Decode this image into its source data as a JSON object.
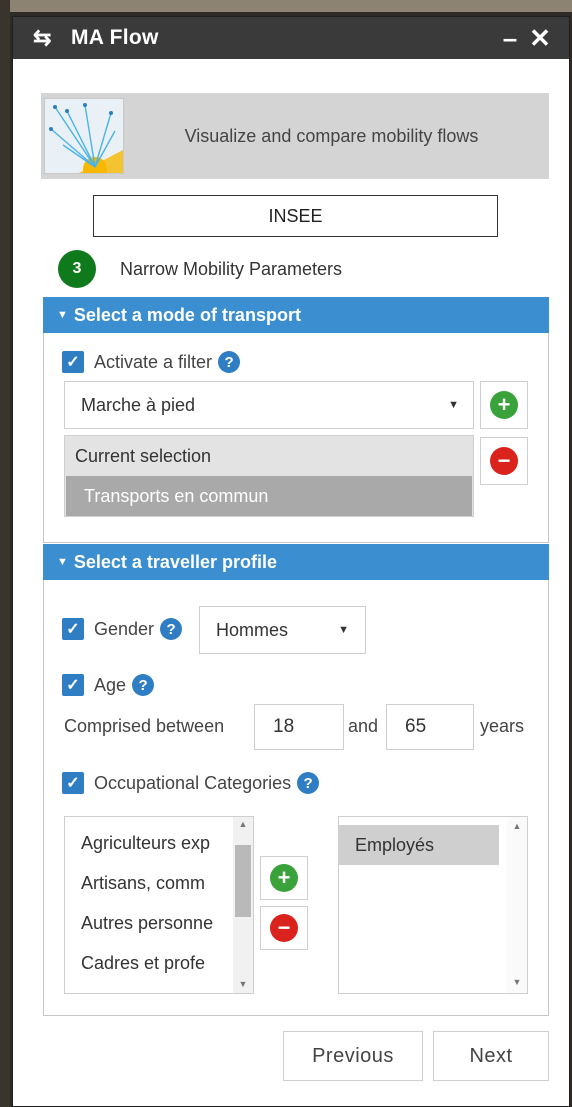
{
  "window": {
    "title": "MA Flow",
    "app_icon": "swap-arrows-icon",
    "minimize_label": "–",
    "close_label": "✕"
  },
  "banner": {
    "text": "Visualize and compare mobility flows",
    "thumbnail": "flow-map-thumbnail"
  },
  "source": {
    "label": "INSEE"
  },
  "step": {
    "number": "3",
    "label": "Narrow Mobility Parameters",
    "badge_color": "#0e7a1b"
  },
  "transport": {
    "header": "Select a mode of transport",
    "filter_label": "Activate a filter",
    "filter_checked": true,
    "mode_value": "Marche à pied",
    "current_selection_label": "Current selection",
    "selected_items": [
      "Transports en commun"
    ]
  },
  "profile": {
    "header": "Select a traveller profile",
    "gender_label": "Gender",
    "gender_checked": true,
    "gender_value": "Hommes",
    "age_label": "Age",
    "age_checked": true,
    "age_prefix": "Comprised between",
    "age_min": "18",
    "age_and": "and",
    "age_max": "65",
    "age_suffix": "years",
    "occ_label": "Occupational Categories",
    "occ_checked": true,
    "occ_available": [
      "Agriculteurs exp",
      "Artisans, comm",
      "Autres personne",
      "Cadres et profe"
    ],
    "occ_selected": [
      "Employés"
    ]
  },
  "footer": {
    "previous_label": "Previous",
    "next_label": "Next"
  },
  "colors": {
    "titlebar": "#3a3a3a",
    "section_header": "#3b8fd0",
    "checkbox": "#2f7ec4",
    "add": "#3aa23a",
    "remove": "#d9231c"
  }
}
